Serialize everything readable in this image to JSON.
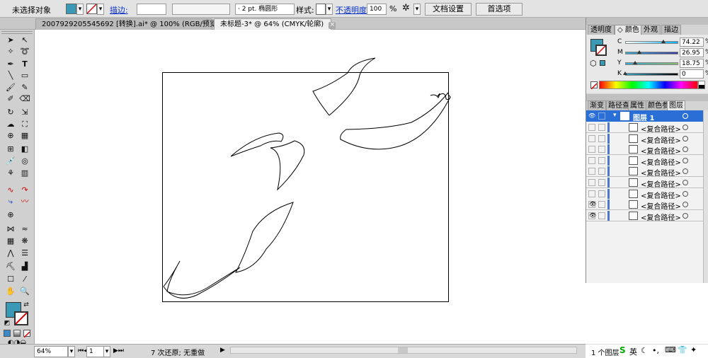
{
  "control_bar": {
    "selection_status": "未选择对象",
    "fill_color": "#3a9ab5",
    "stroke_label": "描边:",
    "stroke_weight_value": "",
    "brush_value": "· 2 pt. 椭圆形",
    "style_label": "样式:",
    "opacity_label": "不透明度:",
    "opacity_value": "100",
    "opacity_unit": "%",
    "doc_setup_button": "文档设置",
    "preferences_button": "首选项"
  },
  "doc_tabs": [
    {
      "label": "2007929205545692 [转换].ai* @ 100% (RGB/预览)",
      "close": "×"
    },
    {
      "label": "未标题-3* @ 64% (CMYK/轮廓)",
      "close": "×"
    }
  ],
  "color_panel": {
    "tabs": [
      "透明度",
      "◇ 颜色",
      "外观",
      "描边"
    ],
    "active_tab": "◇ 颜色",
    "swatch_color": "#3a9ab5",
    "channels": [
      {
        "label": "C",
        "value": "74.22",
        "unit": "%",
        "level": 74.22,
        "gradient": "linear-gradient(to right,#fff,#00aeef)"
      },
      {
        "label": "M",
        "value": "26.95",
        "unit": "%",
        "level": 26.95,
        "gradient": "linear-gradient(to right,#3aa5c8,#3a3aa0)"
      },
      {
        "label": "Y",
        "value": "18.75",
        "unit": "%",
        "level": 18.75,
        "gradient": "linear-gradient(to right,#3aa5c8,#8ab870)"
      },
      {
        "label": "K",
        "value": "0",
        "unit": "%",
        "level": 0,
        "gradient": "linear-gradient(to right,#3aa5c8,#000)"
      }
    ]
  },
  "layers_panel": {
    "tabs": [
      "渐变",
      "路径查",
      "属性",
      "颜色参",
      "图层"
    ],
    "active_tab": "图层",
    "top_layer": {
      "name": "图层 1"
    },
    "items": [
      {
        "name": "<复合路径>",
        "visible": false
      },
      {
        "name": "<复合路径>",
        "visible": false
      },
      {
        "name": "<复合路径>",
        "visible": false
      },
      {
        "name": "<复合路径>",
        "visible": false
      },
      {
        "name": "<复合路径>",
        "visible": false
      },
      {
        "name": "<复合路径>",
        "visible": false
      },
      {
        "name": "<复合路径>",
        "visible": false
      },
      {
        "name": "<复合路径>",
        "visible": true
      },
      {
        "name": "<复合路径>",
        "visible": true
      }
    ],
    "footer": "1 个图层"
  },
  "status_bar": {
    "zoom": "64%",
    "artboard_number": "1",
    "undo_status": "7 次还原; 无重做"
  },
  "tools": {
    "fill_color": "#3a9ab5"
  }
}
